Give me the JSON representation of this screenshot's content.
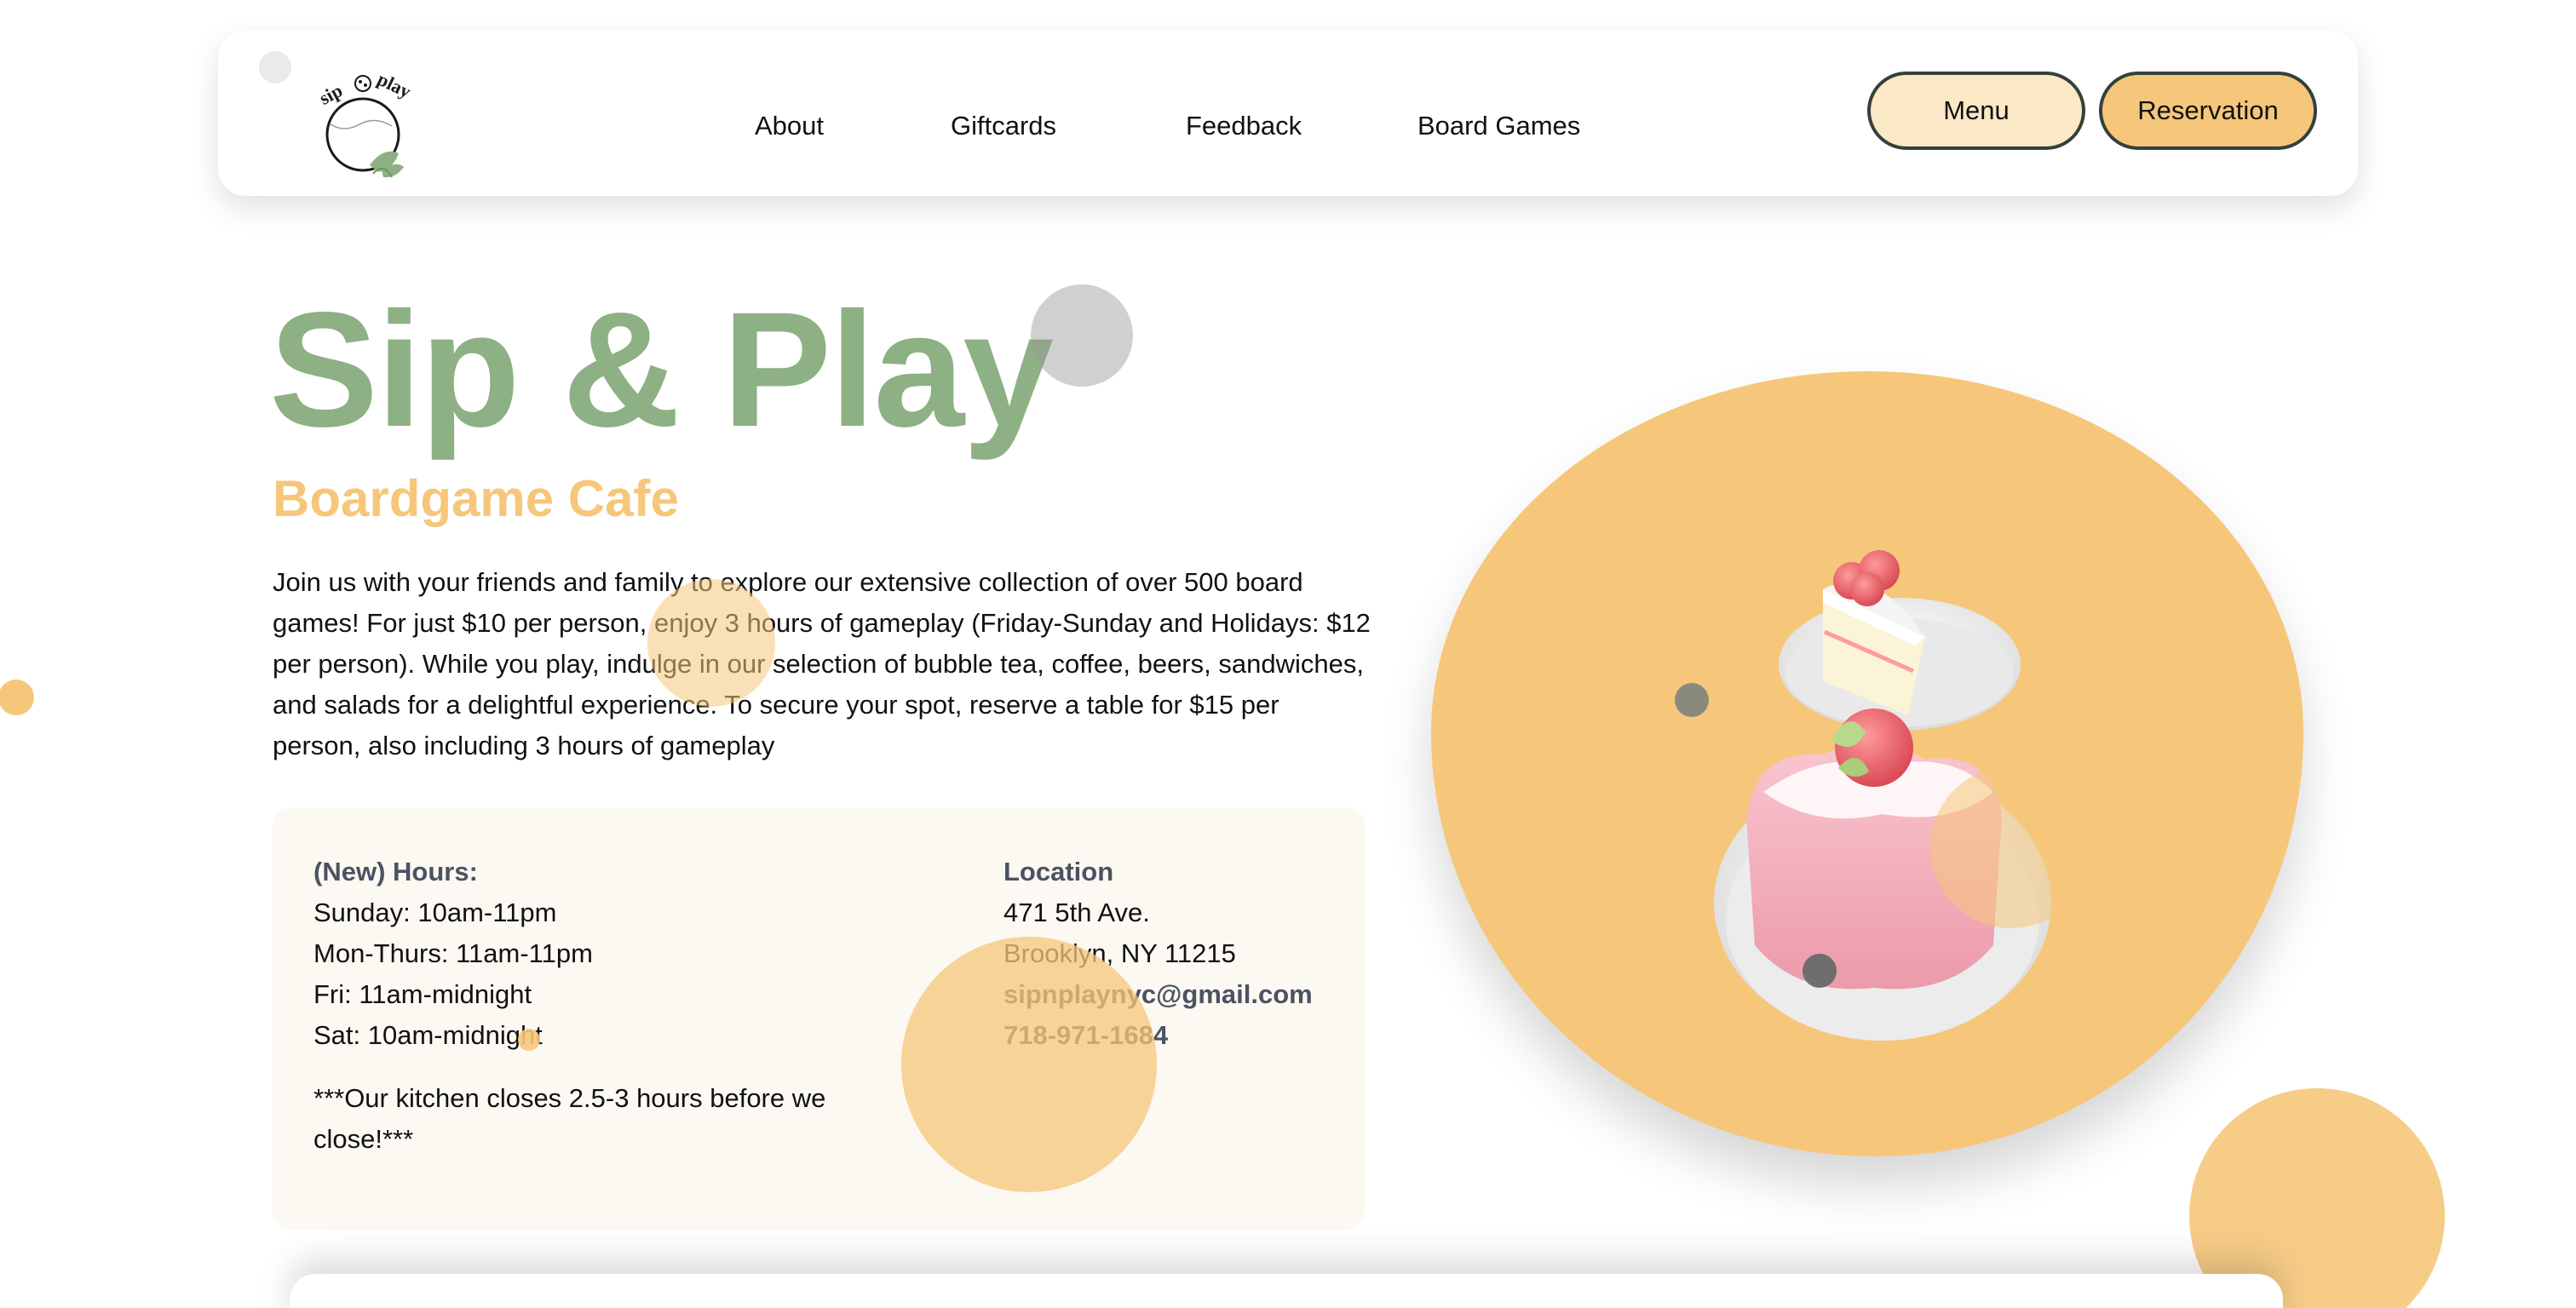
{
  "header": {
    "logo_alt": "sip & play",
    "nav": [
      {
        "label": "About"
      },
      {
        "label": "Giftcards"
      },
      {
        "label": "Feedback"
      },
      {
        "label": "Board Games"
      }
    ],
    "buttons": {
      "menu": "Menu",
      "reservation": "Reservation"
    }
  },
  "hero": {
    "title": "Sip & Play",
    "subtitle": "Boardgame Cafe",
    "description": "Join us with your friends and family to explore our extensive collection of over 500 board games! For just $10 per person, enjoy 3 hours of gameplay (Friday-Sunday and Holidays: $12 per person). While you play, indulge in our selection of bubble tea, coffee, beers, sandwiches, and salads for a delightful experience. To secure your spot, reserve a table for $15 per person, also including 3 hours of gameplay"
  },
  "info": {
    "hours": {
      "heading": "(New) Hours:",
      "lines": [
        "Sunday: 10am-11pm",
        "Mon-Thurs: 11am-11pm",
        "Fri: 11am-midnight",
        "Sat: 10am-midnight"
      ],
      "kitchen_note": "***Our kitchen closes 2.5-3 hours before we close!***"
    },
    "location": {
      "heading": "Location",
      "address_line1": "471 5th Ave.",
      "address_line2": "Brooklyn, NY 11215",
      "email": "sipnplaynyc@gmail.com",
      "phone": "718-971-1684"
    }
  },
  "colors": {
    "brand_green": "#8db084",
    "brand_yellow": "#f6c77a",
    "menu_button": "#fbe8c7",
    "card_bg": "#fcf8f2",
    "dark_text": "#4a5361"
  },
  "icons": {
    "logo": "sip-and-play-logo",
    "illustration": "strawberry-cake-and-pudding-icon"
  }
}
